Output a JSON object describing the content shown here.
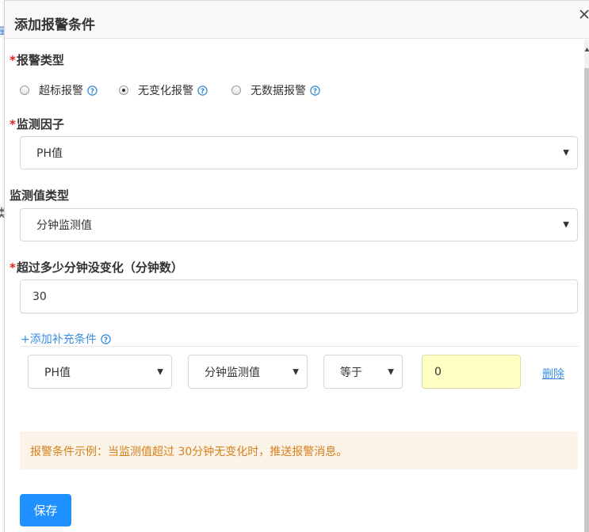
{
  "dialog": {
    "title": "添加报警条件",
    "close_icon": "close-icon"
  },
  "form": {
    "alarm_type": {
      "label": "报警类型",
      "required_mark": "*",
      "options": [
        {
          "label": "超标报警",
          "checked": false
        },
        {
          "label": "无变化报警",
          "checked": true
        },
        {
          "label": "无数据报警",
          "checked": false
        }
      ],
      "help_icon": "question-circle-icon"
    },
    "factor": {
      "label": "监测因子",
      "required_mark": "*",
      "value": "PH值"
    },
    "value_type": {
      "label": "监测值类型",
      "value": "分钟监测值"
    },
    "minutes": {
      "label": "超过多少分钟没变化（分钟数）",
      "required_mark": "*",
      "value": "30"
    },
    "supplement": {
      "add_label": "+添加补充条件",
      "row": {
        "factor": "PH值",
        "value_type": "分钟监测值",
        "operator": "等于",
        "value": "0",
        "delete_label": "删除"
      }
    },
    "note": "报警条件示例：当监测值超过 30分钟无变化时，推送报警消息。",
    "save_label": "保存"
  },
  "colors": {
    "accent": "#1e90ff",
    "link": "#3a8ee6",
    "required": "#e02020",
    "note_bg": "#fcf3e8",
    "note_text": "#d4801c",
    "highlight_input": "#ffffc4"
  }
}
